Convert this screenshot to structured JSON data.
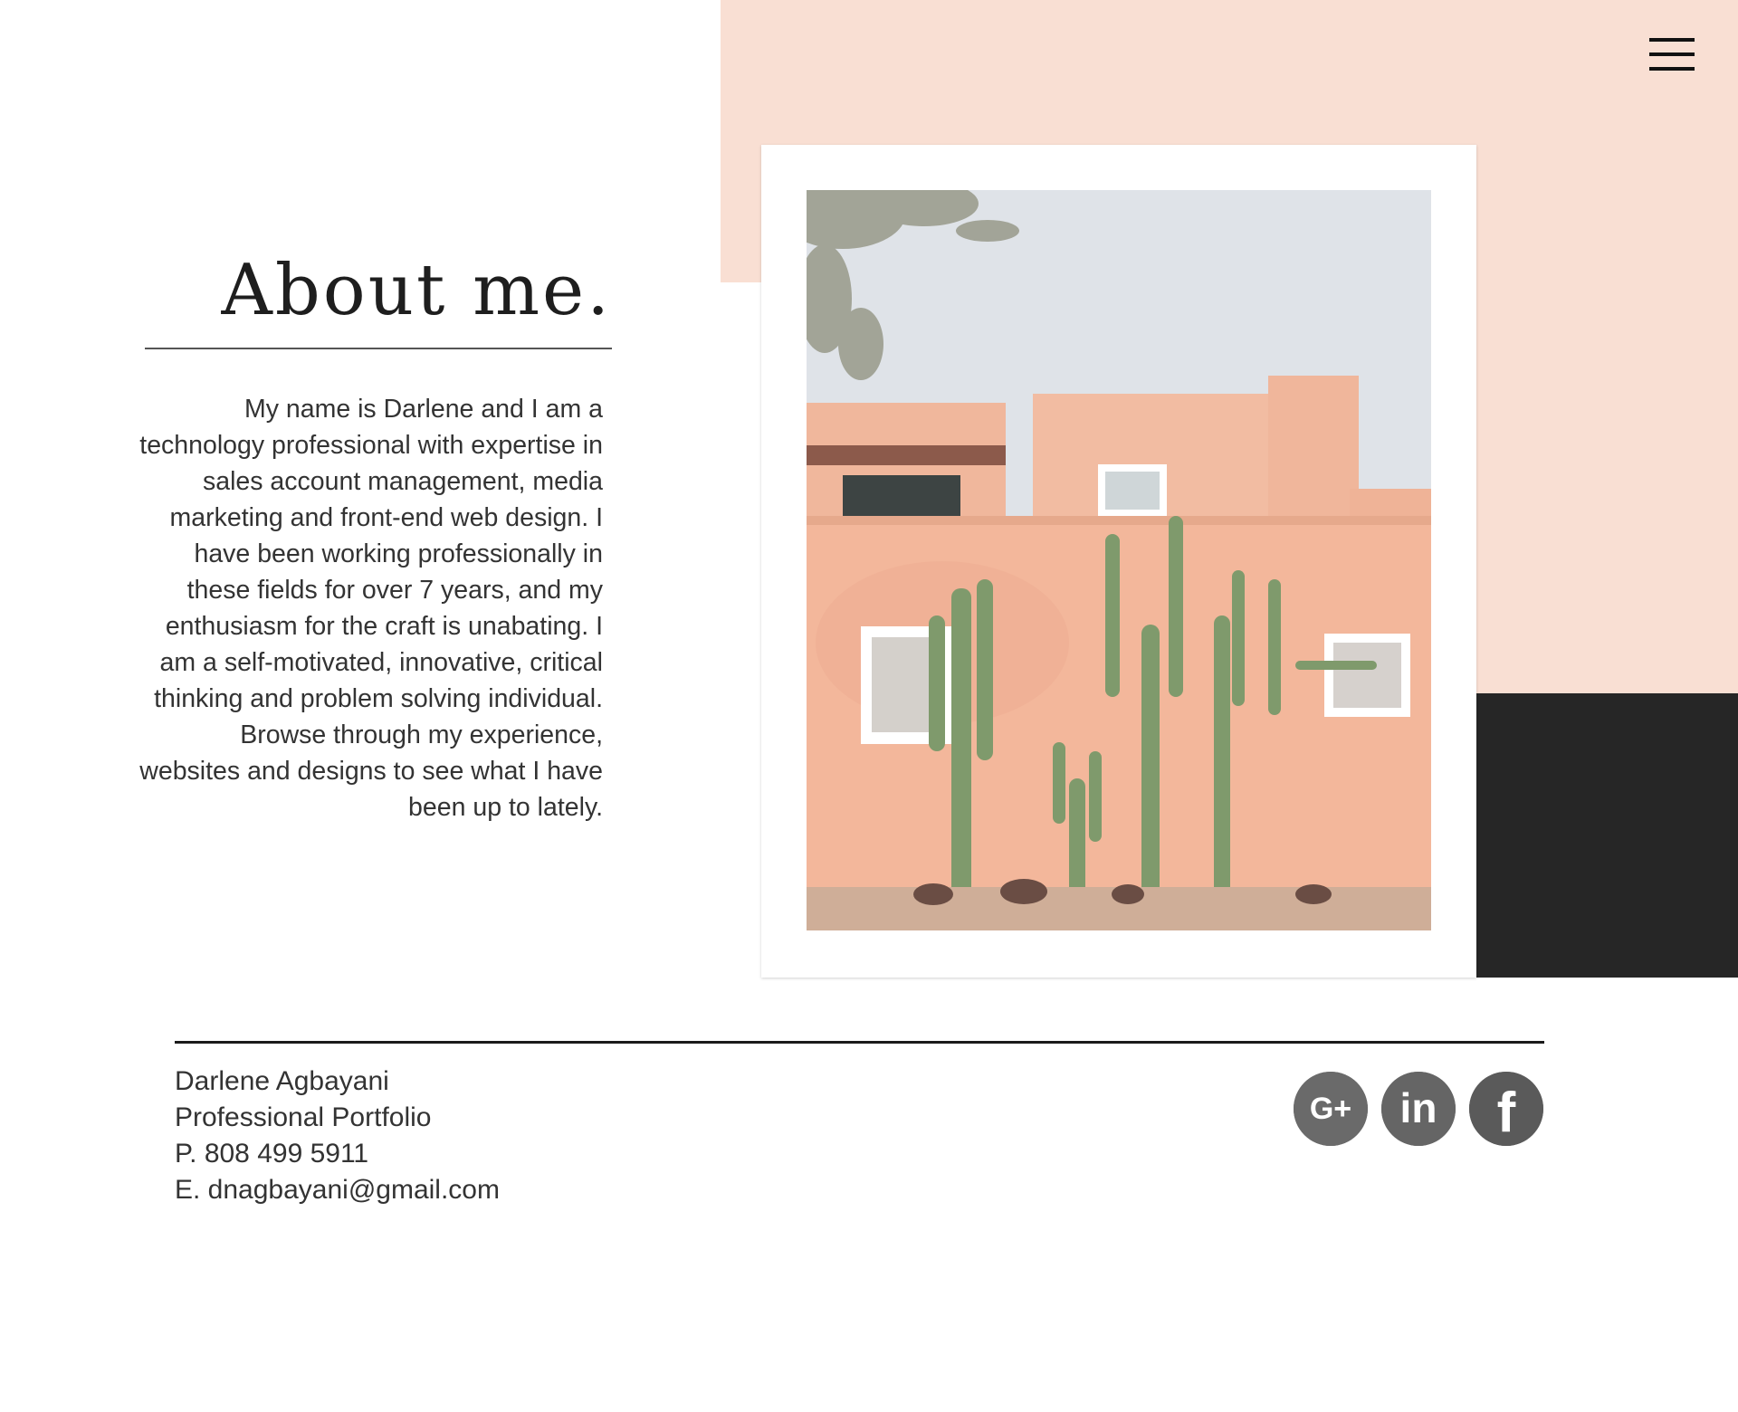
{
  "nav": {
    "menu_icon": "hamburger-icon"
  },
  "about": {
    "title": "About me.",
    "bio": "My name is Darlene and I am a technology professional with expertise in sales account management, media marketing and front-end web design. I have been working professionally in these fields for over 7 years, and my enthusiasm for the craft is unabating. I am a self-motivated, innovative, critical thinking and problem solving individual. Browse through my experience, websites and designs to see what I have been up to lately."
  },
  "footer": {
    "name": "Darlene Agbayani",
    "subtitle": "Professional Portfolio",
    "phone": "P. 808 499 5911",
    "email": "E. dnagbayani@gmail.com"
  },
  "socials": [
    {
      "icon": "google-plus-icon",
      "label": "G+"
    },
    {
      "icon": "linkedin-icon",
      "label": "in"
    },
    {
      "icon": "facebook-icon",
      "label": "f"
    }
  ],
  "colors": {
    "pink": "#f9dfd3",
    "dark": "#262626",
    "social_gray": "#5f5f5f"
  }
}
